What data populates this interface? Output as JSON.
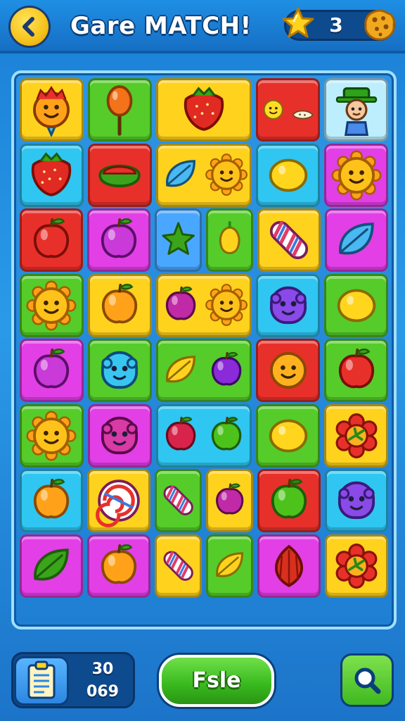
{
  "header": {
    "title": "Gare MATCH!",
    "score": "3",
    "icons": [
      "back-arrow-icon",
      "star-icon",
      "cookie-icon"
    ]
  },
  "colors": {
    "header_bg": "#1e8fe4",
    "board_border": "#9fe0ff",
    "accent_yellow": "#ffd21e",
    "button_green": "#37b81d"
  },
  "board": {
    "rows": [
      [
        {
          "color": "yellow",
          "span": 1,
          "items": [
            "sun-face-ice-cream-icon"
          ]
        },
        {
          "color": "green",
          "span": 1,
          "items": [
            "lollipop-icon"
          ]
        },
        {
          "color": "yellow",
          "span": 1.5,
          "items": [
            "strawberry-icon"
          ]
        },
        {
          "color": "red",
          "span": 1,
          "items": [
            "smiley-lemon-icon",
            "cookie-crumb-icon"
          ]
        },
        {
          "color": "lightcyan",
          "span": 1,
          "items": [
            "farmer-character-icon"
          ]
        }
      ],
      [
        {
          "color": "cyan",
          "span": 1,
          "items": [
            "strawberry-icon"
          ]
        },
        {
          "color": "red",
          "span": 1,
          "items": [
            "watermelon-slice-icon"
          ]
        },
        {
          "color": "yellow",
          "span": 1.5,
          "items": [
            "blue-leaf-icon",
            "sun-face-icon"
          ]
        },
        {
          "color": "cyan",
          "span": 1,
          "items": [
            "lemon-icon"
          ]
        },
        {
          "color": "magenta",
          "span": 1,
          "items": [
            "sun-face-icon"
          ]
        }
      ],
      [
        {
          "color": "red",
          "span": 1,
          "items": [
            "apple-icon"
          ]
        },
        {
          "color": "magenta",
          "span": 1,
          "items": [
            "plum-icon"
          ]
        },
        {
          "color": "blue",
          "span": 0.75,
          "items": [
            "green-star-fruit-icon"
          ]
        },
        {
          "color": "green",
          "span": 0.75,
          "items": [
            "yellow-pepper-icon"
          ]
        },
        {
          "color": "yellow",
          "span": 1,
          "items": [
            "striped-candy-icon"
          ]
        },
        {
          "color": "magenta",
          "span": 1,
          "items": [
            "blue-leaf-icon"
          ]
        }
      ],
      [
        {
          "color": "green",
          "span": 1,
          "items": [
            "sun-face-icon"
          ]
        },
        {
          "color": "yellow",
          "span": 1,
          "items": [
            "orange-icon"
          ]
        },
        {
          "color": "yellow",
          "span": 1.5,
          "items": [
            "radish-icon",
            "sun-face-icon"
          ]
        },
        {
          "color": "cyan",
          "span": 1,
          "items": [
            "purple-blob-icon"
          ]
        },
        {
          "color": "green",
          "span": 1,
          "items": [
            "lemon-icon"
          ]
        }
      ],
      [
        {
          "color": "magenta",
          "span": 1,
          "items": [
            "plum-icon"
          ]
        },
        {
          "color": "green",
          "span": 1,
          "items": [
            "blue-blob-icon"
          ]
        },
        {
          "color": "green",
          "span": 1.5,
          "items": [
            "yellow-leaf-icon",
            "eggplant-icon"
          ]
        },
        {
          "color": "red",
          "span": 1,
          "items": [
            "smiley-orange-icon"
          ]
        },
        {
          "color": "green",
          "span": 1,
          "items": [
            "apple-icon"
          ]
        }
      ],
      [
        {
          "color": "green",
          "span": 1,
          "items": [
            "sun-face-icon"
          ]
        },
        {
          "color": "magenta",
          "span": 1,
          "items": [
            "pink-blob-icon"
          ]
        },
        {
          "color": "cyan",
          "span": 1.5,
          "items": [
            "red-radish-icon",
            "green-pepper-icon"
          ]
        },
        {
          "color": "green",
          "span": 1,
          "items": [
            "lemon-icon"
          ]
        },
        {
          "color": "yellow",
          "span": 1,
          "items": [
            "red-flower-icon"
          ]
        }
      ],
      [
        {
          "color": "cyan",
          "span": 1,
          "items": [
            "orange-icon"
          ]
        },
        {
          "color": "yellow",
          "span": 1,
          "items": [
            "swirl-candy-icon"
          ]
        },
        {
          "color": "green",
          "span": 0.75,
          "items": [
            "striped-candy-icon"
          ]
        },
        {
          "color": "yellow",
          "span": 0.75,
          "items": [
            "radish-icon"
          ]
        },
        {
          "color": "red",
          "span": 1,
          "items": [
            "green-apple-icon"
          ]
        },
        {
          "color": "cyan",
          "span": 1,
          "items": [
            "purple-blob-icon"
          ]
        }
      ],
      [
        {
          "color": "magenta",
          "span": 1,
          "items": [
            "green-leaf-icon"
          ]
        },
        {
          "color": "magenta",
          "span": 1,
          "items": [
            "orange-icon"
          ]
        },
        {
          "color": "yellow",
          "span": 0.75,
          "items": [
            "striped-candy-icon"
          ]
        },
        {
          "color": "green",
          "span": 0.75,
          "items": [
            "yellow-leaf-icon"
          ]
        },
        {
          "color": "magenta",
          "span": 1,
          "items": [
            "onion-icon"
          ]
        },
        {
          "color": "yellow",
          "span": 1,
          "items": [
            "red-flower-icon"
          ]
        }
      ]
    ]
  },
  "footer": {
    "stat_top": "30",
    "stat_bottom": "069",
    "main_button_label": "Fsle",
    "icons": [
      "clipboard-icon",
      "search-icon"
    ]
  }
}
